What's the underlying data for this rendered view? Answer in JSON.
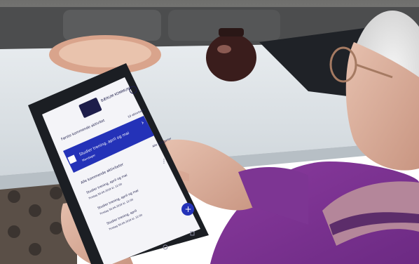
{
  "app": {
    "logo_text": "BÆRUM KOMMUNE",
    "info_label": "i"
  },
  "sections": {
    "upcoming_header": "Første kommende aktivitet",
    "all_header": "Alle kommende aktiviteter",
    "count_badge": "10 aktiviteter"
  },
  "featured": {
    "title": "Studier trening, april og mai",
    "subtitle": "Mandager",
    "chevron": "›"
  },
  "list": {
    "filter_label": "Alle kategorier",
    "items": [
      {
        "title": "Studier trening, april og mai",
        "subtitle": "Tirsdag 30.04.2019 kl. 11:00"
      },
      {
        "title": "Studier trening, april og mai",
        "subtitle": "Tirsdag 30.04.2019 kl. 11:00"
      },
      {
        "title": "Studier trening, april",
        "subtitle": "Tirsdag 30.04.2019 kl. 11:00"
      }
    ]
  },
  "fab": {
    "label": "+"
  },
  "colors": {
    "accent": "#2432b8",
    "screen_bg": "#f4f4f8",
    "tablet_frame": "#1b1e23"
  }
}
